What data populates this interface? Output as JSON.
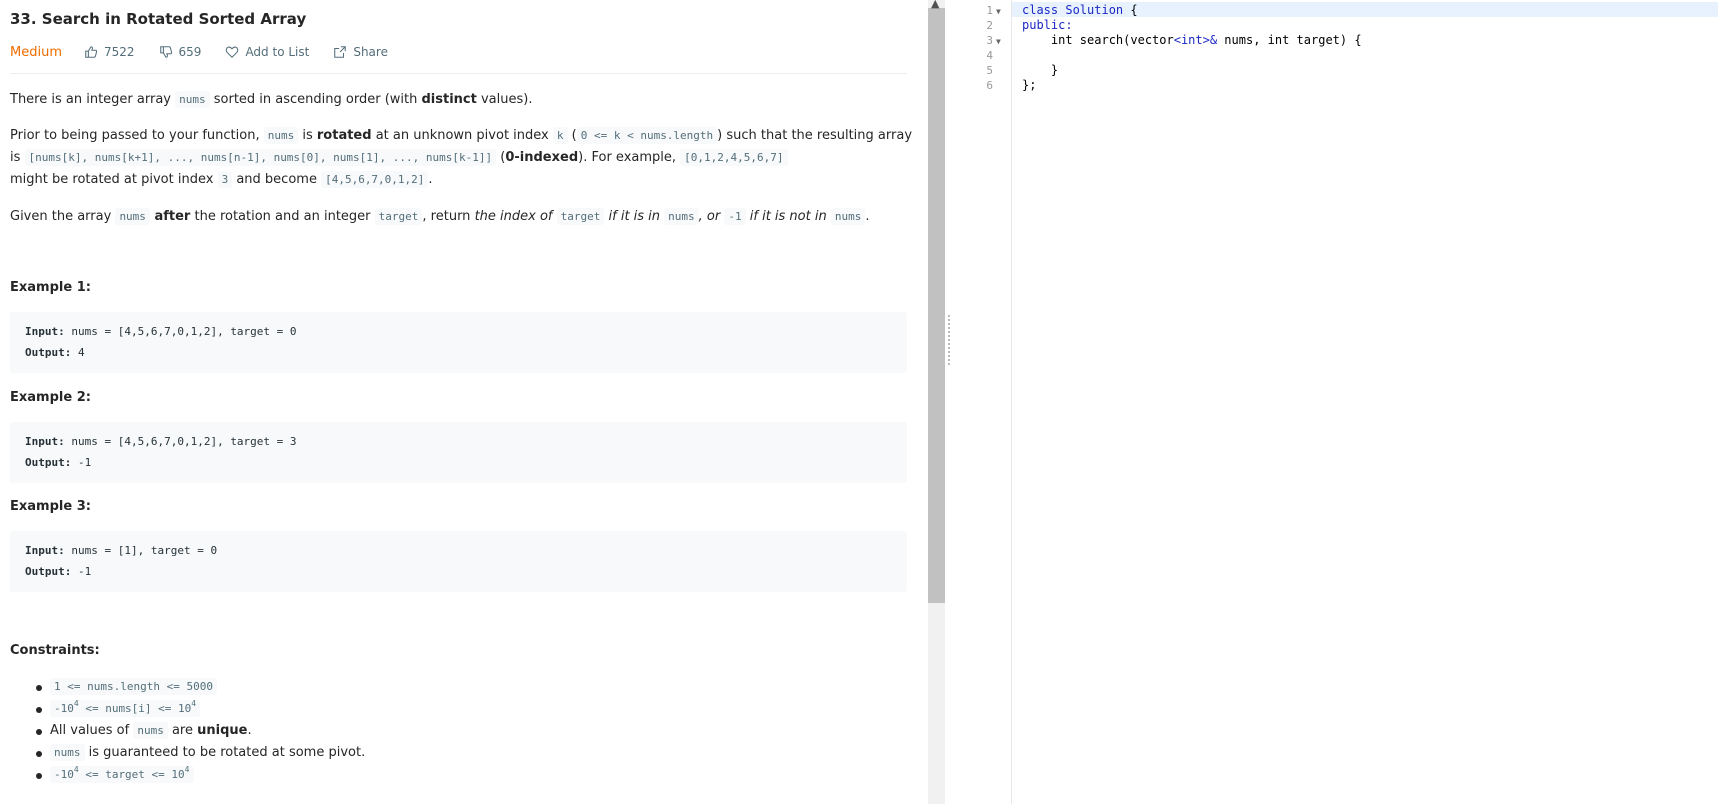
{
  "problem": {
    "title": "33. Search in Rotated Sorted Array",
    "difficulty": "Medium",
    "likes": "7522",
    "dislikes": "659",
    "add_to_list": "Add to List",
    "share": "Share"
  },
  "description": {
    "p1": {
      "a": "There is an integer array ",
      "b": "nums",
      "c": " sorted in ascending order (with ",
      "d": "distinct",
      "e": " values)."
    },
    "p2": {
      "a": "Prior to being passed to your function, ",
      "b": "nums",
      "c": " is ",
      "d": "rotated",
      "e": " at an unknown pivot index ",
      "f": "k",
      "g": " (",
      "h": "0 <= k < nums.length",
      "i": ") such that the resulting array",
      "j": "is ",
      "k": "[nums[k], nums[k+1], ..., nums[n-1], nums[0], nums[1], ..., nums[k-1]]",
      "l": " (",
      "m": "0-indexed",
      "n": "). For example, ",
      "o": "[0,1,2,4,5,6,7]",
      "p": "might be rotated at pivot index ",
      "q": "3",
      "r": " and become ",
      "s": "[4,5,6,7,0,1,2]",
      "t": "."
    },
    "p3": {
      "a": "Given the array ",
      "b": "nums",
      "c": " after",
      "d": " the rotation and an integer ",
      "e": "target",
      "f": ", return ",
      "g": "the index of ",
      "h": "target",
      "i": " if it is in ",
      "j": "nums",
      "k": ", or ",
      "l": "-1",
      "m": " if it is not in ",
      "n": "nums",
      "o": "."
    }
  },
  "examples": [
    {
      "heading": "Example 1:",
      "input_label": "Input:",
      "input": " nums = [4,5,6,7,0,1,2], target = 0",
      "output_label": "Output:",
      "output": " 4"
    },
    {
      "heading": "Example 2:",
      "input_label": "Input:",
      "input": " nums = [4,5,6,7,0,1,2], target = 3",
      "output_label": "Output:",
      "output": " -1"
    },
    {
      "heading": "Example 3:",
      "input_label": "Input:",
      "input": " nums = [1], target = 0",
      "output_label": "Output:",
      "output": " -1"
    }
  ],
  "constraints": {
    "heading": "Constraints:",
    "c1": "1 <= nums.length <= 5000",
    "c2a": "-10",
    "c2b": "4",
    "c2c": " <= nums[i] <= 10",
    "c2d": "4",
    "c3a": "All values of ",
    "c3b": "nums",
    "c3c": " are ",
    "c3d": "unique",
    "c3e": ".",
    "c4a": "nums",
    "c4b": " is guaranteed to be rotated at some pivot.",
    "c5a": "-10",
    "c5b": "4",
    "c5c": " <= target <= 10",
    "c5d": "4"
  },
  "editor": {
    "line_numbers": [
      "1",
      "2",
      "3",
      "4",
      "5",
      "6"
    ],
    "lines": {
      "l1a": "class ",
      "l1b": "Solution",
      "l1c": " {",
      "l2": "public:",
      "l3a": "    int search(vector",
      "l3b": "<int>",
      "l3c": "& ",
      "l3d": "nums, int target) {",
      "l5": "    }",
      "l6": "};"
    }
  },
  "colors": {
    "accent": "#ef6c00",
    "keyword": "#1b29c4",
    "code_bg": "#f7f9fa"
  }
}
